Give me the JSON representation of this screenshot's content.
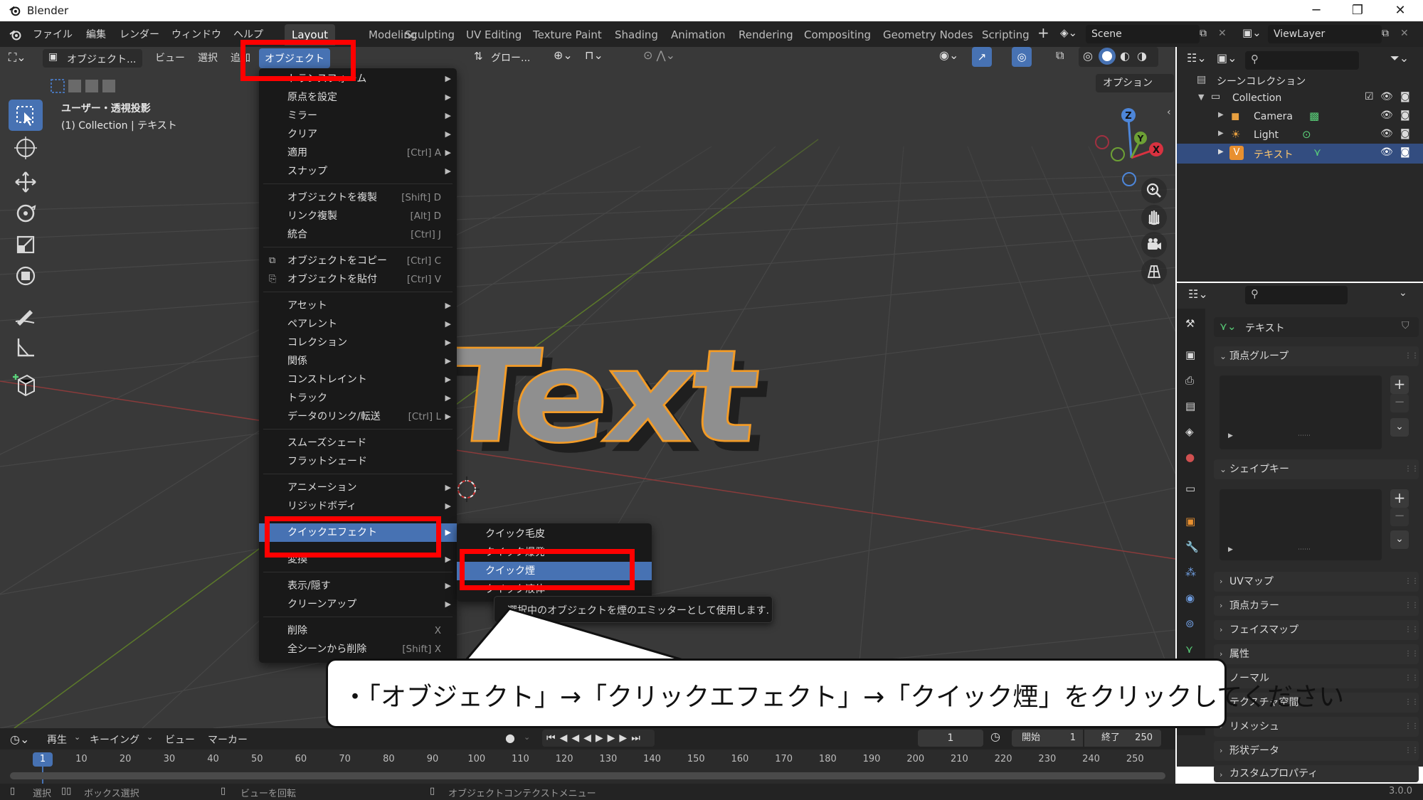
{
  "window": {
    "title": "Blender",
    "controls": [
      "─",
      "❐",
      "✕"
    ]
  },
  "top_menu": [
    "ファイル",
    "編集",
    "レンダー",
    "ウィンドウ",
    "ヘルプ"
  ],
  "workspace_tabs": [
    "Layout",
    "Modeling",
    "Sculpting",
    "UV Editing",
    "Texture Paint",
    "Shading",
    "Animation",
    "Rendering",
    "Compositing",
    "Geometry Nodes",
    "Scripting"
  ],
  "active_tab": "Layout",
  "add_tab": "+",
  "scene": "Scene",
  "view_layer": "ViewLayer",
  "viewport_header": {
    "mode": "オブジェクト...",
    "menus": [
      "ビュー",
      "選択",
      "追加",
      "オブジェクト"
    ],
    "orientation": "グロー...",
    "options": "オプション"
  },
  "viewport_overlay": {
    "line1": "ユーザー・透視投影",
    "line2": "(1) Collection | テキスト"
  },
  "scene_text": "Text",
  "object_menu": {
    "items": [
      {
        "label": "トランスフォーム",
        "shortcut": "",
        "submenu": true
      },
      {
        "label": "原点を設定",
        "shortcut": "",
        "submenu": true
      },
      {
        "label": "ミラー",
        "shortcut": "",
        "submenu": true
      },
      {
        "label": "クリア",
        "shortcut": "",
        "submenu": true
      },
      {
        "label": "適用",
        "shortcut": "[Ctrl] A",
        "submenu": true
      },
      {
        "label": "スナップ",
        "shortcut": "",
        "submenu": true
      },
      {
        "label": "オブジェクトを複製",
        "shortcut": "[Shift] D",
        "submenu": false
      },
      {
        "label": "リンク複製",
        "shortcut": "[Alt] D",
        "submenu": false
      },
      {
        "label": "統合",
        "shortcut": "[Ctrl] J",
        "submenu": false
      },
      {
        "label": "オブジェクトをコピー",
        "shortcut": "[Ctrl] C",
        "submenu": false
      },
      {
        "label": "オブジェクトを貼付",
        "shortcut": "[Ctrl] V",
        "submenu": false
      },
      {
        "label": "アセット",
        "shortcut": "",
        "submenu": true
      },
      {
        "label": "ペアレント",
        "shortcut": "",
        "submenu": true
      },
      {
        "label": "コレクション",
        "shortcut": "",
        "submenu": true
      },
      {
        "label": "関係",
        "shortcut": "",
        "submenu": true
      },
      {
        "label": "コンストレイント",
        "shortcut": "",
        "submenu": true
      },
      {
        "label": "トラック",
        "shortcut": "",
        "submenu": true
      },
      {
        "label": "データのリンク/転送",
        "shortcut": "[Ctrl] L",
        "submenu": true
      },
      {
        "label": "スムーズシェード",
        "shortcut": "",
        "submenu": false
      },
      {
        "label": "フラットシェード",
        "shortcut": "",
        "submenu": false
      },
      {
        "label": "アニメーション",
        "shortcut": "",
        "submenu": true
      },
      {
        "label": "リジッドボディ",
        "shortcut": "",
        "submenu": true
      },
      {
        "label": "クイックエフェクト",
        "shortcut": "",
        "submenu": true
      },
      {
        "label": "変換",
        "shortcut": "",
        "submenu": true
      },
      {
        "label": "表示/隠す",
        "shortcut": "",
        "submenu": true
      },
      {
        "label": "クリーンアップ",
        "shortcut": "",
        "submenu": true
      },
      {
        "label": "削除",
        "shortcut": "X",
        "submenu": false
      },
      {
        "label": "全シーンから削除",
        "shortcut": "[Shift] X",
        "submenu": false
      }
    ]
  },
  "quick_effects_menu": {
    "items": [
      "クイック毛皮",
      "クイック爆発",
      "クイック煙",
      "クイック液体"
    ],
    "highlighted": "クイック煙",
    "tooltip": "選択中のオブジェクトを煙のエミッターとして使用します."
  },
  "outliner": {
    "root": "シーンコレクション",
    "collection": "Collection",
    "objects": [
      "Camera",
      "Light",
      "テキスト"
    ]
  },
  "properties": {
    "object_name": "テキスト",
    "panels_open": [
      "頂点グループ",
      "シェイプキー"
    ],
    "panels_closed": [
      "UVマップ",
      "頂点カラー",
      "フェイスマップ",
      "属性",
      "ノーマル",
      "テクスチャ空間",
      "リメッシュ",
      "形状データ",
      "カスタムプロパティ"
    ]
  },
  "timeline": {
    "menus": [
      "再生",
      "キーイング",
      "ビュー",
      "マーカー"
    ],
    "current_frame": "1",
    "start_label": "開始",
    "start": "1",
    "end_label": "終了",
    "end": "250",
    "ticks": [
      "1",
      "10",
      "20",
      "30",
      "40",
      "50",
      "60",
      "70",
      "80",
      "90",
      "100",
      "110",
      "120",
      "130",
      "140",
      "150",
      "160",
      "170",
      "180",
      "190",
      "200",
      "210",
      "220",
      "230",
      "240",
      "250"
    ]
  },
  "statusbar": {
    "select": "選択",
    "box_select": "ボックス選択",
    "rotate_view": "ビューを回転",
    "context_menu": "オブジェクトコンテクストメニュー",
    "version": "3.0.0"
  },
  "callout": {
    "text": "・「オブジェクト」→「クリックエフェクト」→「クイック煙」をクリックしてください"
  },
  "colors": {
    "accent": "#4772b3",
    "annotation": "#ff0000",
    "selection_outline": "#f29b27"
  }
}
